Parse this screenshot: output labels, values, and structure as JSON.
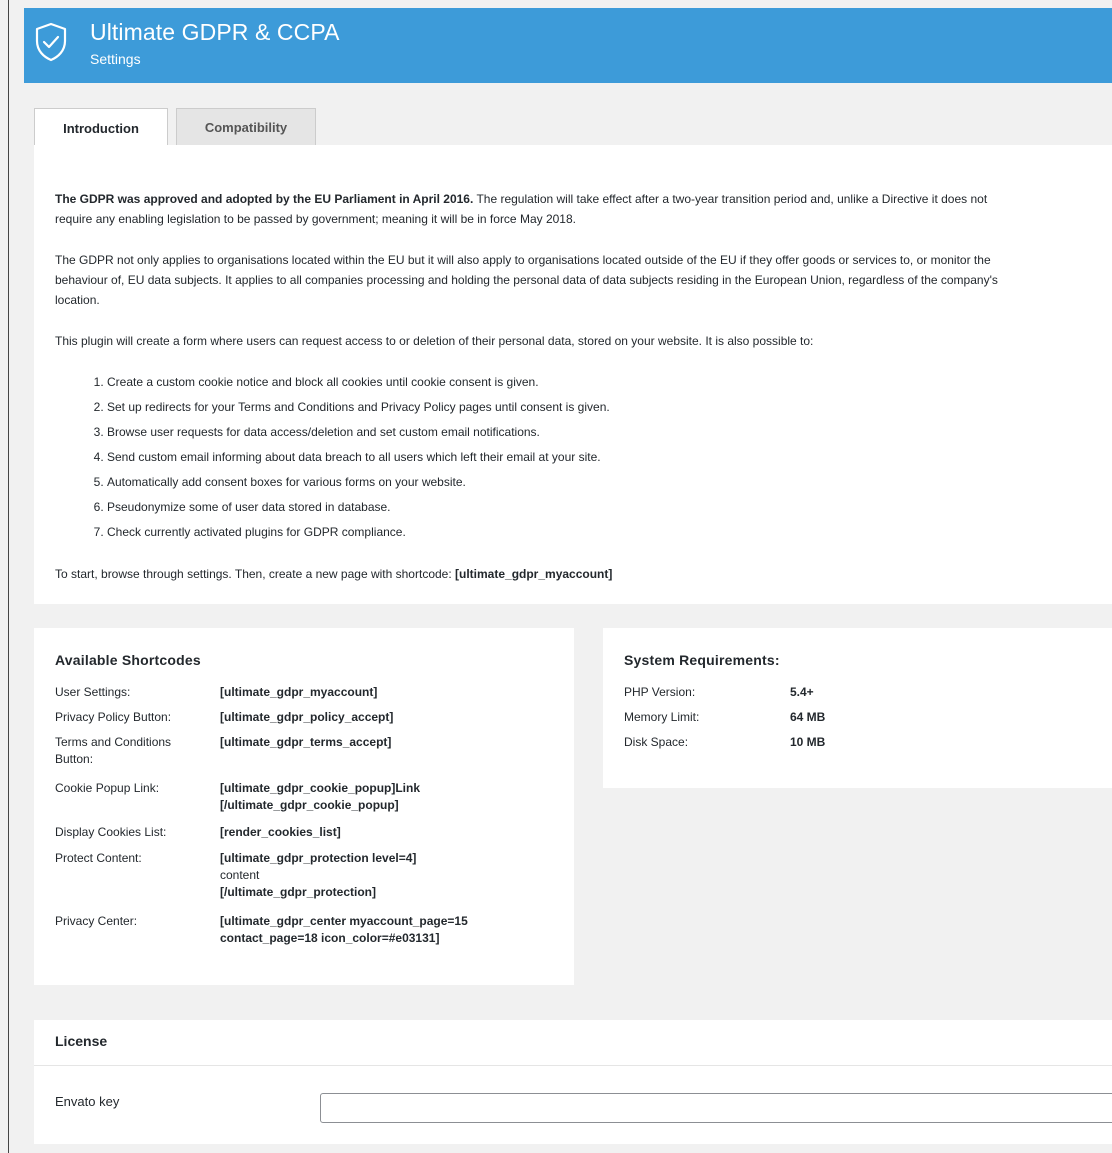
{
  "header": {
    "title": "Ultimate GDPR & CCPA",
    "subtitle": "Settings",
    "icon": "shield-check-icon",
    "color": "#3d9bd9"
  },
  "tabs": [
    {
      "label": "Introduction",
      "active": true
    },
    {
      "label": "Compatibility",
      "active": false
    }
  ],
  "intro": {
    "p1_bold": "The GDPR was approved and adopted by the EU Parliament in April 2016.",
    "p1_line1": " The regulation will take effect after a two-year transition period and, unlike a Directive it does not",
    "p1_line2": "require any enabling legislation to be passed by government; meaning it will be in force May 2018.",
    "p2_line1": "The GDPR not only applies to organisations located within the EU but it will also apply to organisations located outside of the EU if they offer goods or services to, or monitor the",
    "p2_line2": "behaviour of, EU data subjects. It applies to all companies processing and holding the personal data of data subjects residing in the European Union, regardless of the company's",
    "p2_line3": "location.",
    "p3": "This plugin will create a form where users can request access to or deletion of their personal data, stored on your website. It is also possible to:",
    "list": [
      "Create a custom cookie notice and block all cookies until cookie consent is given.",
      "Set up redirects for your Terms and Conditions and Privacy Policy pages until consent is given.",
      "Browse user requests for data access/deletion and set custom email notifications.",
      "Send custom email informing about data breach to all users which left their email at your site.",
      "Automatically add consent boxes for various forms on your website.",
      "Pseudonymize some of user data stored in database.",
      "Check currently activated plugins for GDPR compliance."
    ],
    "start_text": "To start, browse through settings. Then, create a new page with shortcode: ",
    "start_code": "[ultimate_gdpr_myaccount]"
  },
  "shortcodes": {
    "title": "Available Shortcodes",
    "rows": [
      {
        "label": "User Settings:",
        "line1": "[ultimate_gdpr_myaccount]"
      },
      {
        "label": "Privacy Policy Button:",
        "line1": "[ultimate_gdpr_policy_accept]"
      },
      {
        "label_line1": "Terms and Conditions",
        "label_line2": "Button:",
        "line1": "[ultimate_gdpr_terms_accept]"
      },
      {
        "label": "Cookie Popup Link:",
        "line1": "[ultimate_gdpr_cookie_popup]Link",
        "line2": "[/ultimate_gdpr_cookie_popup]"
      },
      {
        "label": "Display Cookies List:",
        "line1": "[render_cookies_list]"
      },
      {
        "label": "Protect Content:",
        "line1": "[ultimate_gdpr_protection level=4]",
        "line2": "content",
        "line3": "[/ultimate_gdpr_protection]"
      },
      {
        "label": "Privacy Center:",
        "line1": "[ultimate_gdpr_center myaccount_page=15",
        "line2": "contact_page=18 icon_color=#e03131]"
      }
    ]
  },
  "system": {
    "title": "System Requirements:",
    "rows": [
      {
        "label": "PHP Version:",
        "value": "5.4+"
      },
      {
        "label": "Memory Limit:",
        "value": "64 MB"
      },
      {
        "label": "Disk Space:",
        "value": "10 MB"
      }
    ]
  },
  "license": {
    "title": "License",
    "field_label": "Envato key",
    "field_value": "",
    "field_placeholder": ""
  }
}
